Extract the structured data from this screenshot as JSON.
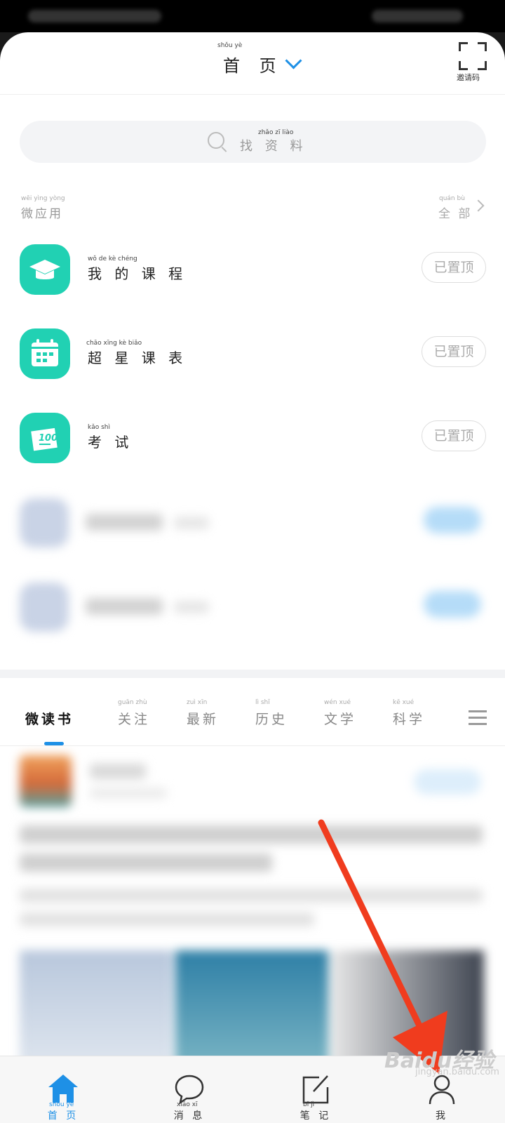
{
  "header": {
    "title": "首 页",
    "title_pinyin": "shǒu   yè",
    "scan_label": "邀请码"
  },
  "search": {
    "placeholder": "找 资 料",
    "pinyin": "zhǎo  zī  liào"
  },
  "apps_section": {
    "title": "微应用",
    "title_pinyin": "wēi yìng yòng",
    "all_label": "全 部",
    "all_pinyin": "quán  bù"
  },
  "apps": [
    {
      "name": "我 的 课 程",
      "pinyin": "wǒ   de   kè  chéng",
      "pin_label": "已置顶"
    },
    {
      "name": "超 星 课 表",
      "pinyin": "chāo xīng  kè  biǎo",
      "pin_label": "已置顶"
    },
    {
      "name": "考 试",
      "pinyin": "kǎo  shì",
      "pin_label": "已置顶"
    }
  ],
  "tabs": [
    {
      "label": "微读书",
      "pinyin": ""
    },
    {
      "label": "关注",
      "pinyin": "guān zhù"
    },
    {
      "label": "最新",
      "pinyin": "zuì  xīn"
    },
    {
      "label": "历史",
      "pinyin": "lì   shǐ"
    },
    {
      "label": "文学",
      "pinyin": "wén xué"
    },
    {
      "label": "科学",
      "pinyin": "kē  xué"
    }
  ],
  "bottom_nav": [
    {
      "label": "首 页",
      "pinyin": "shǒu yè",
      "icon": "home-icon",
      "active": true
    },
    {
      "label": "消 息",
      "pinyin": "xiāo  xī",
      "icon": "chat-icon",
      "active": false
    },
    {
      "label": "笔 记",
      "pinyin": "bǐ   jì",
      "icon": "note-icon",
      "active": false
    },
    {
      "label": "我",
      "pinyin": "",
      "icon": "person-icon",
      "active": false
    }
  ],
  "watermark": {
    "text": "Baidu经验",
    "sub": "jingyan.baidu.com"
  },
  "colors": {
    "accent": "#1e90e6",
    "app_teal": "#21d1b3",
    "annotation_arrow": "#f03c1e"
  }
}
